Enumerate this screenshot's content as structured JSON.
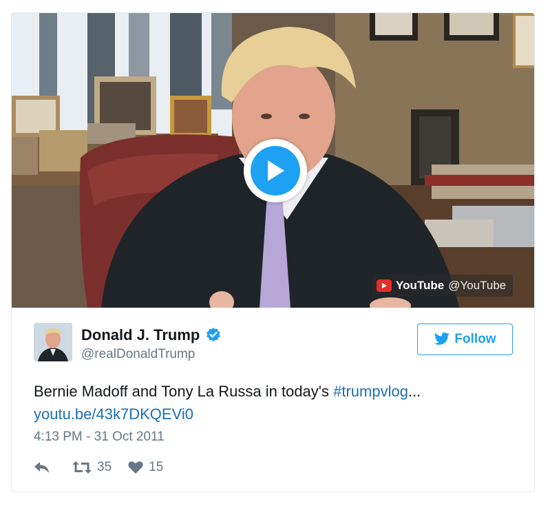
{
  "video": {
    "source_brand": "YouTube",
    "source_handle": "@YouTube"
  },
  "tweet": {
    "author_name": "Donald J. Trump",
    "author_handle": "@realDonaldTrump",
    "verified": true,
    "text_prefix": "Bernie Madoff and Tony La Russa in today's ",
    "hashtag": "#trumpvlog",
    "ellipsis": "...",
    "link": "youtu.be/43k7DKQEVi0",
    "timestamp": "4:13 PM - 31 Oct 2011",
    "retweets": "35",
    "likes": "15"
  },
  "follow_button": {
    "label": "Follow"
  },
  "colors": {
    "accent": "#1da1f2",
    "link": "#1b6fb5",
    "muted": "#657786",
    "youtube_red": "#e52d27"
  },
  "icons": {
    "play": "play-icon",
    "youtube": "youtube-logo-icon",
    "verified": "verified-badge-icon",
    "follow": "twitter-bird-icon",
    "reply": "reply-icon",
    "retweet": "retweet-icon",
    "like": "heart-icon"
  }
}
